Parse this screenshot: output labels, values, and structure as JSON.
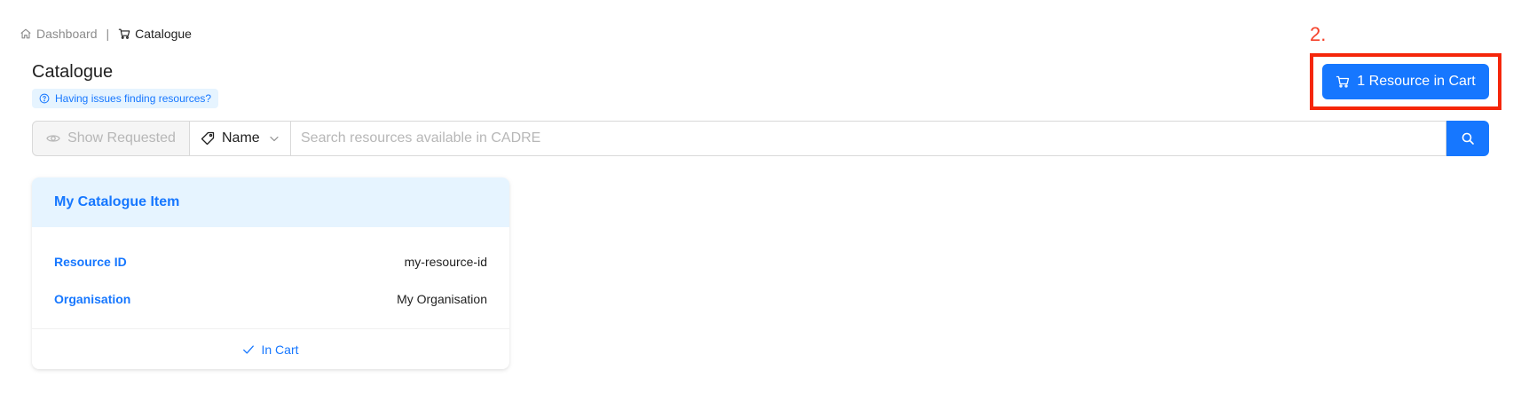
{
  "breadcrumb": {
    "items": [
      {
        "label": "Dashboard",
        "icon": "home-icon"
      },
      {
        "label": "Catalogue",
        "icon": "cart-icon"
      }
    ],
    "separator": "|"
  },
  "header": {
    "title": "Catalogue",
    "help_label": "Having issues finding resources?"
  },
  "annotation": {
    "step": "2.",
    "color": "#f5260a"
  },
  "cart": {
    "label": "1 Resource in Cart"
  },
  "search": {
    "show_requested_label": "Show Requested",
    "field_selected": "Name",
    "placeholder": "Search resources available in CADRE",
    "value": ""
  },
  "card": {
    "title": "My Catalogue Item",
    "rows": [
      {
        "label": "Resource ID",
        "value": "my-resource-id"
      },
      {
        "label": "Organisation",
        "value": "My Organisation"
      }
    ],
    "footer_label": "In Cart"
  },
  "colors": {
    "primary": "#1677ff",
    "primary_light": "#e6f4ff",
    "annotation": "#f5260a"
  }
}
